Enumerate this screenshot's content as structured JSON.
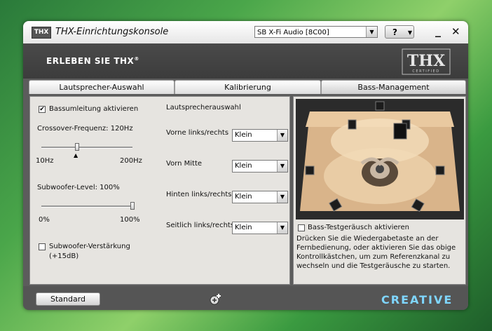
{
  "window": {
    "title": "THX-Einrichtungskonsole",
    "logo_text": "THX",
    "device": "SB X-Fi Audio [8C00]",
    "help_label": "?",
    "minimize_label": "_",
    "close_label": "✕"
  },
  "banner": {
    "text": "ERLEBEN SIE THX",
    "trademark": "®",
    "logo_main": "THX",
    "logo_sub": "CERTIFIED"
  },
  "tabs": [
    {
      "label": "Lautsprecher-Auswahl",
      "active": false
    },
    {
      "label": "Kalibrierung",
      "active": false
    },
    {
      "label": "Bass-Management",
      "active": true
    }
  ],
  "bass": {
    "redirect_label": "Bassumleitung aktivieren",
    "redirect_checked": true,
    "crossover_label": "Crossover-Frequenz: 120Hz",
    "crossover_min": "10Hz",
    "crossover_max": "200Hz",
    "crossover_level": 0.39,
    "sub_level_label": "Subwoofer-Level: 100%",
    "sub_min": "0%",
    "sub_max": "100%",
    "sub_level": 1.0,
    "boost_label_line1": "Subwoofer-Verstärkung",
    "boost_label_line2": "(+15dB)",
    "boost_checked": false
  },
  "speakers": {
    "heading": "Lautsprecherauswahl",
    "rows": [
      {
        "label": "Vorne links/rechts",
        "value": "Klein"
      },
      {
        "label": "Vorn Mitte",
        "value": "Klein"
      },
      {
        "label": "Hinten links/rechts",
        "value": "Klein"
      },
      {
        "label": "Seitlich links/rechts",
        "value": "Klein"
      }
    ]
  },
  "test": {
    "label": "Bass-Testgeräusch aktivieren",
    "checked": false,
    "hint": "Drücken Sie die Wiedergabetaste an der Fernbedienung, oder aktivieren Sie das obige Kontrollkästchen, um zum Referenzkanal zu wechseln und die Testgeräusche zu starten."
  },
  "footer": {
    "standard_label": "Standard",
    "brand": "CREATIVE"
  }
}
